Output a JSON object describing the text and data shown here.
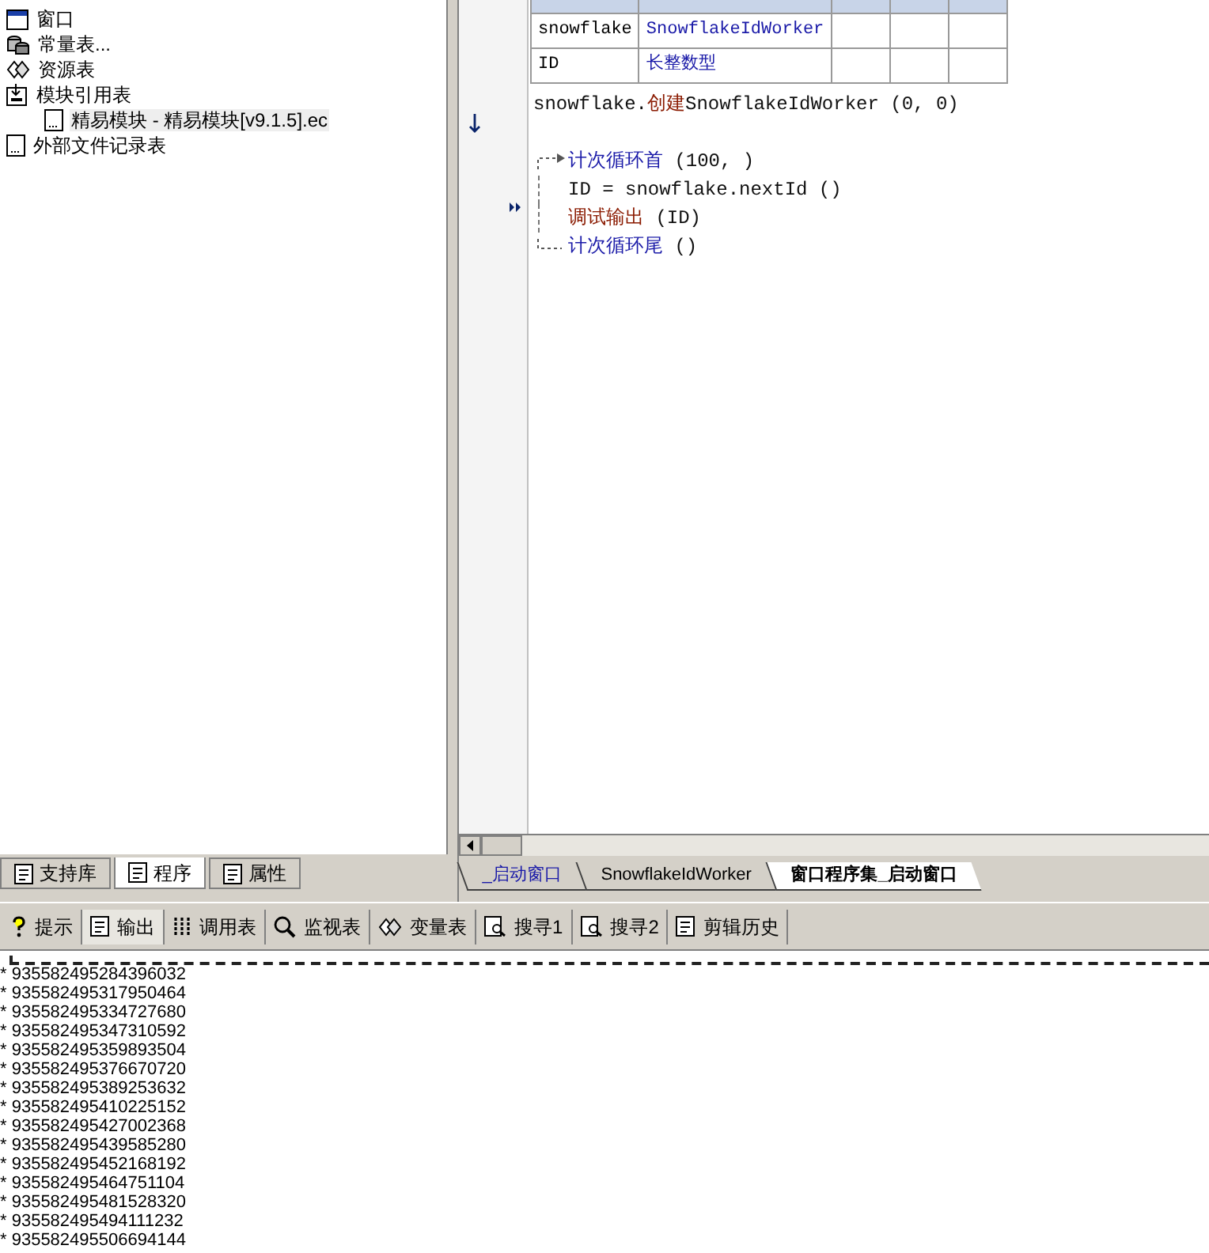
{
  "tree": [
    {
      "label": "窗口",
      "kind": "window"
    },
    {
      "label": "常量表...",
      "kind": "db"
    },
    {
      "label": "资源表",
      "kind": "res"
    },
    {
      "label": "模块引用表",
      "kind": "module",
      "children": [
        {
          "label": "精易模块 - 精易模块[v9.1.5].ec",
          "kind": "file",
          "selected": true
        }
      ]
    },
    {
      "label": "外部文件记录表",
      "kind": "file"
    }
  ],
  "left_tabs": [
    {
      "label": "支持库",
      "selected": false
    },
    {
      "label": "程序",
      "selected": true
    },
    {
      "label": "属性",
      "selected": false
    }
  ],
  "variables": [
    {
      "name": "snowflake",
      "type": "SnowflakeIdWorker"
    },
    {
      "name": "ID",
      "type": "长整数型"
    }
  ],
  "code": [
    {
      "kind": "plain",
      "segments": [
        {
          "text": "snowflake.",
          "kind": "plain"
        },
        {
          "text": "创建",
          "kind": "method"
        },
        {
          "text": "SnowflakeIdWorker (0, 0)",
          "kind": "plain"
        }
      ]
    },
    {
      "kind": "blank"
    },
    {
      "kind": "loop-start",
      "segments": [
        {
          "text": "计次循环首",
          "kind": "keyword"
        },
        {
          "text": " (100, )",
          "kind": "plain"
        }
      ]
    },
    {
      "kind": "loop-body",
      "segments": [
        {
          "text": "ID = snowflake.nextId ()",
          "kind": "plain"
        }
      ]
    },
    {
      "kind": "loop-body",
      "segments": [
        {
          "text": "调试输出",
          "kind": "method"
        },
        {
          "text": " (ID)",
          "kind": "plain"
        }
      ]
    },
    {
      "kind": "loop-end",
      "segments": [
        {
          "text": "计次循环尾",
          "kind": "keyword"
        },
        {
          "text": " ()",
          "kind": "plain"
        }
      ]
    }
  ],
  "editor_tabs": [
    {
      "label": "_启动窗口",
      "selected": false
    },
    {
      "label": "SnowflakeIdWorker",
      "selected": false
    },
    {
      "label": "窗口程序集_启动窗口",
      "selected": true
    }
  ],
  "bottom_tabs": [
    {
      "label": "提示",
      "kind": "hint",
      "selected": false
    },
    {
      "label": "输出",
      "kind": "doc",
      "selected": true
    },
    {
      "label": "调用表",
      "kind": "grid",
      "selected": false
    },
    {
      "label": "监视表",
      "kind": "search",
      "selected": false
    },
    {
      "label": "变量表",
      "kind": "res",
      "selected": false
    },
    {
      "label": "搜寻1",
      "kind": "find",
      "selected": false
    },
    {
      "label": "搜寻2",
      "kind": "find",
      "selected": false
    },
    {
      "label": "剪辑历史",
      "kind": "doc",
      "selected": false
    }
  ],
  "output": [
    "* 935582495284396032",
    "* 935582495317950464",
    "* 935582495334727680",
    "* 935582495347310592",
    "* 935582495359893504",
    "* 935582495376670720",
    "* 935582495389253632",
    "* 935582495410225152",
    "* 935582495427002368",
    "* 935582495439585280",
    "* 935582495452168192",
    "* 935582495464751104",
    "* 935582495481528320",
    "* 935582495494111232",
    "* 935582495506694144"
  ]
}
